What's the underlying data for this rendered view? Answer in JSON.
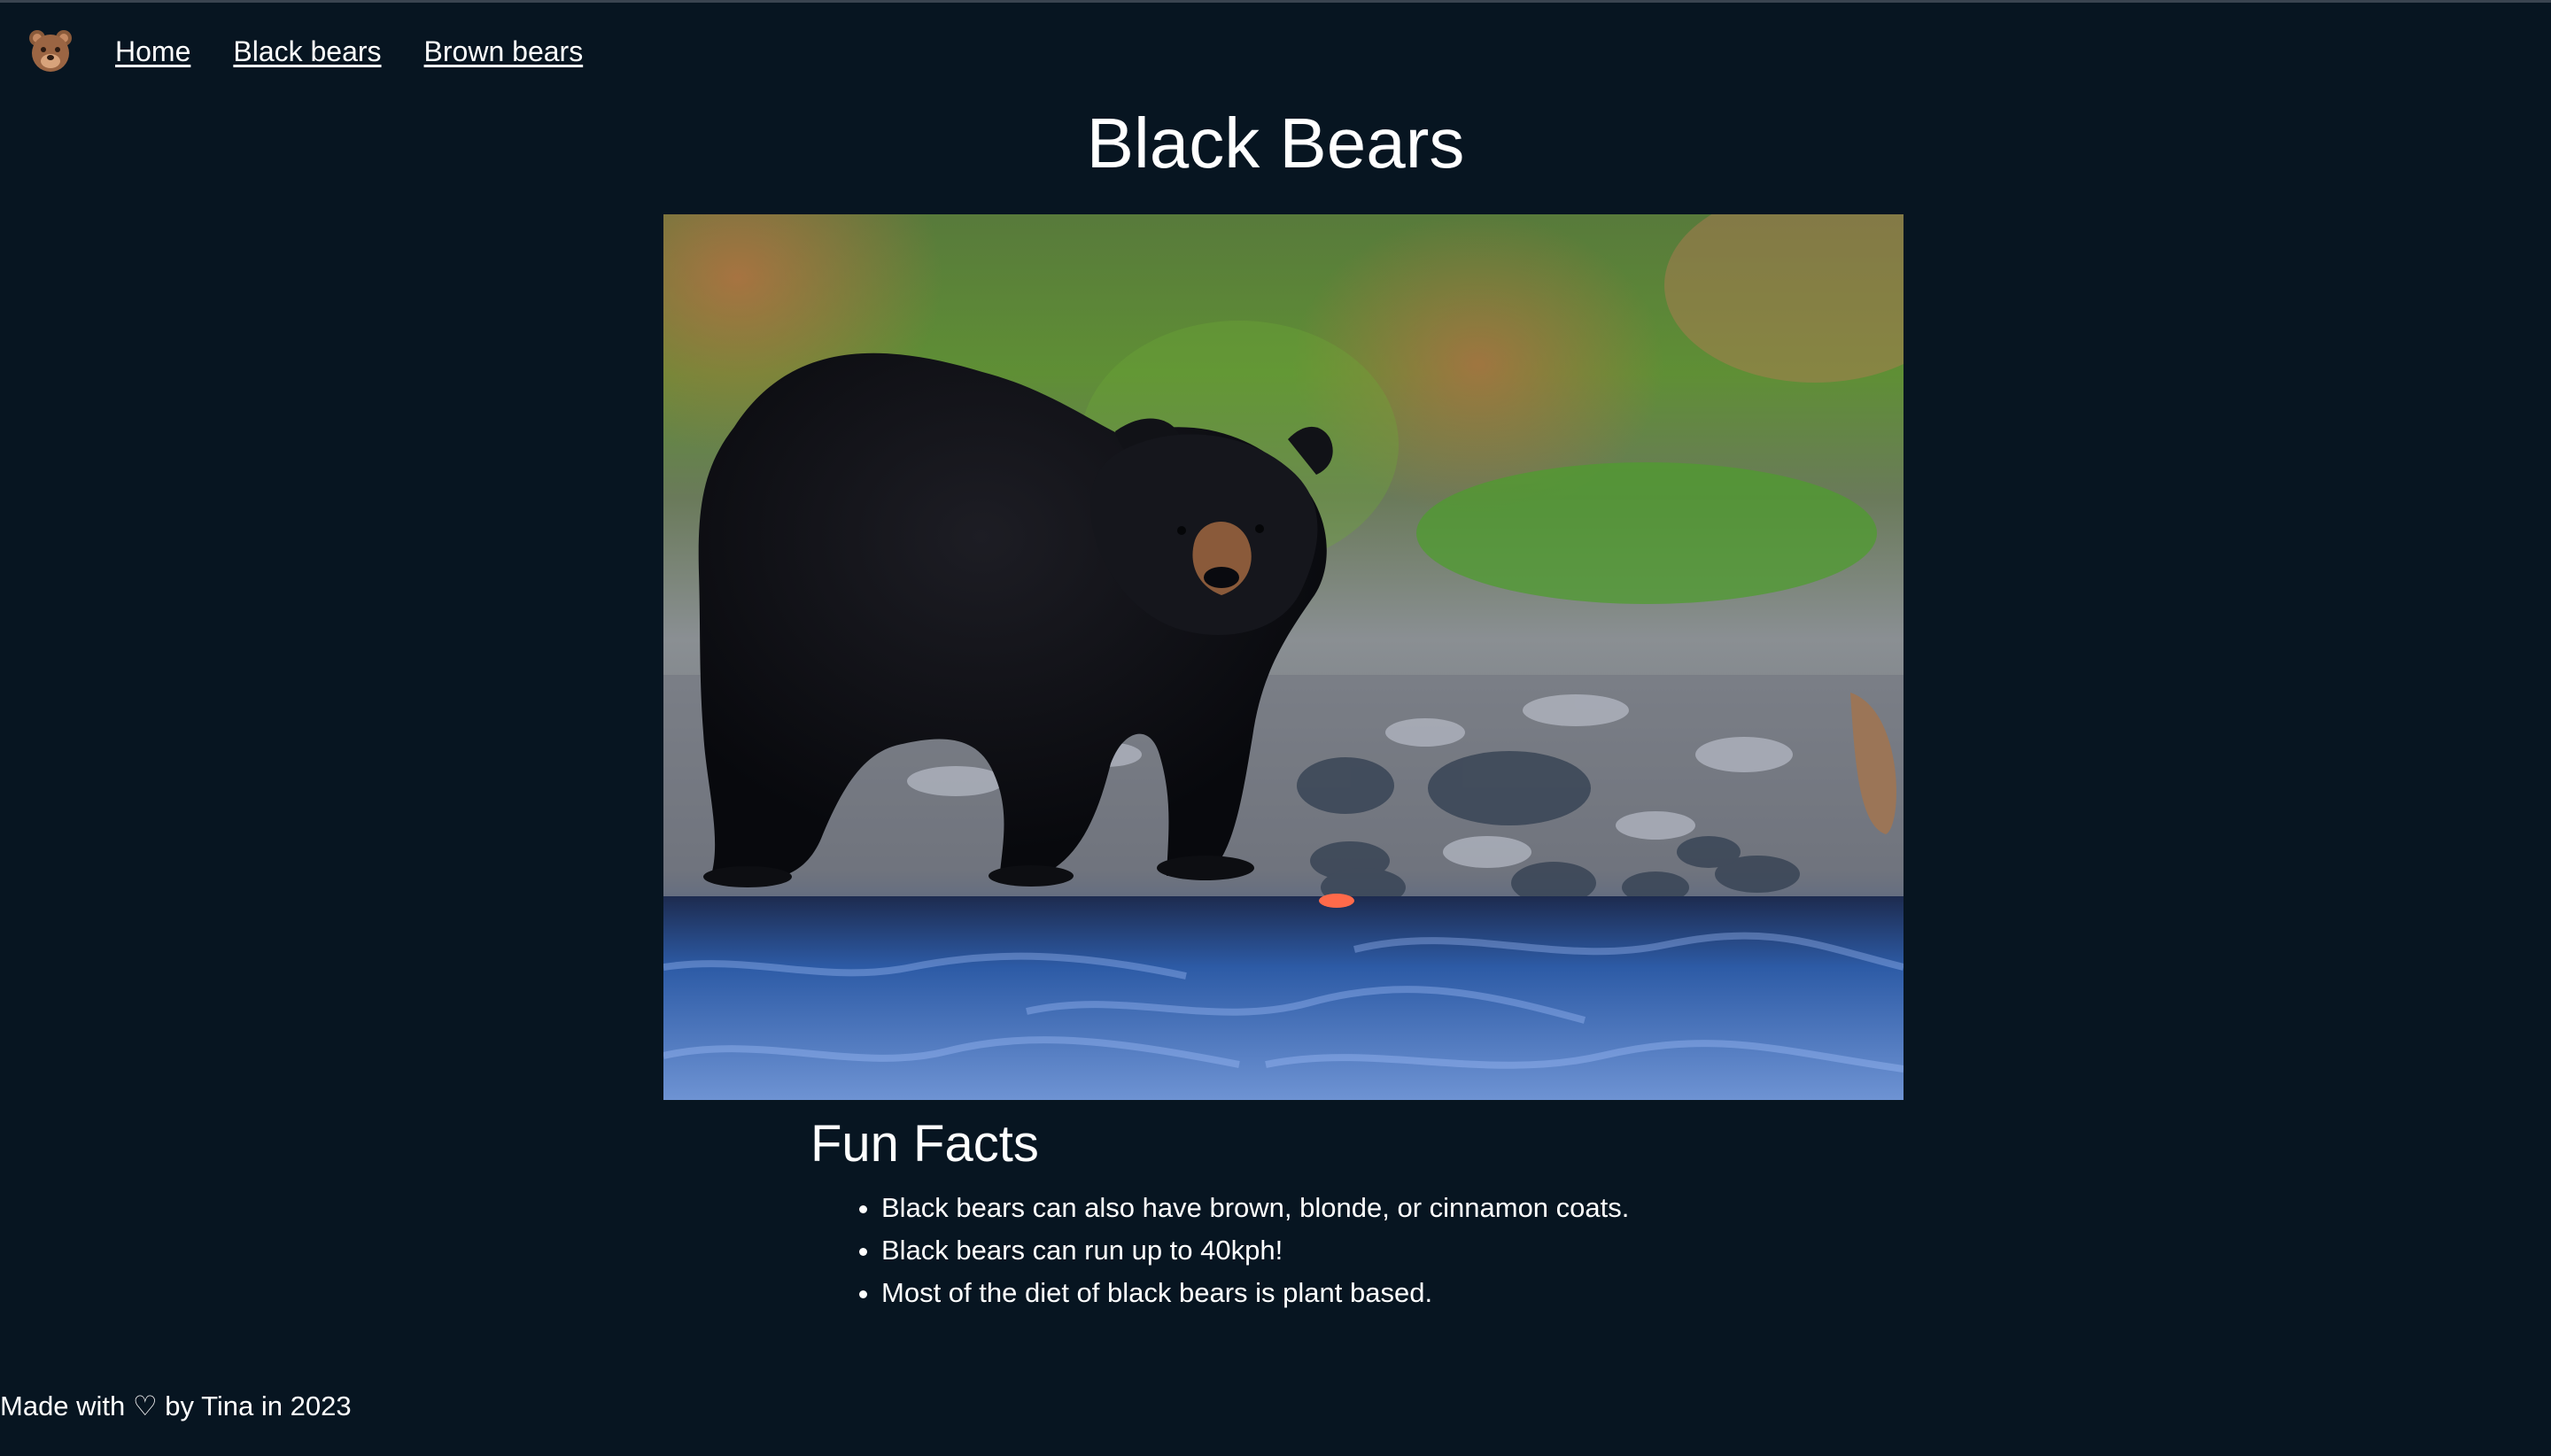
{
  "nav": {
    "logo_icon": "bear-face-icon",
    "items": [
      {
        "label": "Home"
      },
      {
        "label": "Black bears"
      },
      {
        "label": "Brown bears"
      }
    ]
  },
  "main": {
    "title": "Black Bears",
    "image_icon": "black-bear-photo",
    "facts_heading": "Fun Facts",
    "facts": [
      "Black bears can also have brown, blonde, or cinnamon coats.",
      "Black bears can run up to 40kph!",
      "Most of the diet of black bears is plant based."
    ]
  },
  "footer": {
    "text": "Made with ♡ by Tina in 2023"
  },
  "colors": {
    "background": "#071521",
    "text": "#ffffff"
  }
}
